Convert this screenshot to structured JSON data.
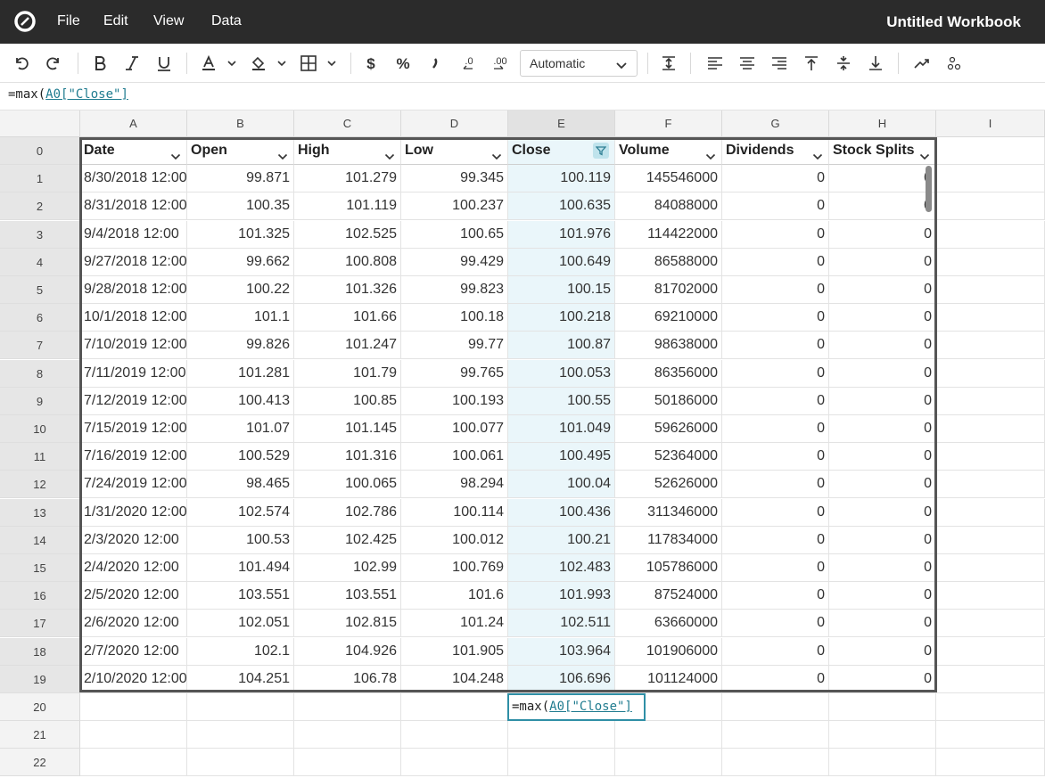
{
  "app": {
    "menu": [
      "File",
      "Edit",
      "View",
      "Data"
    ],
    "title": "Untitled Workbook"
  },
  "toolbar": {
    "number_format": "Automatic",
    "icons": [
      "undo-icon",
      "redo-icon",
      "bold-icon",
      "italic-icon",
      "underline-icon",
      "text-color-icon",
      "fill-color-icon",
      "borders-icon",
      "currency-icon",
      "percent-icon",
      "comma-icon",
      "decrease-decimal-icon",
      "increase-decimal-icon",
      "row-height-icon",
      "align-left-icon",
      "align-center-icon",
      "align-right-icon",
      "align-top-icon",
      "align-middle-icon",
      "align-bottom-icon",
      "chart-icon",
      "more-icon"
    ]
  },
  "formula_bar": {
    "prefix": "=max(",
    "ref": "A0[\"Close\"]"
  },
  "columns": [
    "A",
    "B",
    "C",
    "D",
    "E",
    "F",
    "G",
    "H",
    "I"
  ],
  "selected_column": "E",
  "table": {
    "headers": [
      "Date",
      "Open",
      "High",
      "Low",
      "Close",
      "Volume",
      "Dividends",
      "Stock Splits"
    ],
    "rows": [
      [
        "8/30/2018 12:00",
        "99.871",
        "101.279",
        "99.345",
        "100.119",
        "145546000",
        "0",
        "0"
      ],
      [
        "8/31/2018 12:00",
        "100.35",
        "101.119",
        "100.237",
        "100.635",
        "84088000",
        "0",
        "0"
      ],
      [
        "9/4/2018 12:00",
        "101.325",
        "102.525",
        "100.65",
        "101.976",
        "114422000",
        "0",
        "0"
      ],
      [
        "9/27/2018 12:00",
        "99.662",
        "100.808",
        "99.429",
        "100.649",
        "86588000",
        "0",
        "0"
      ],
      [
        "9/28/2018 12:00",
        "100.22",
        "101.326",
        "99.823",
        "100.15",
        "81702000",
        "0",
        "0"
      ],
      [
        "10/1/2018 12:00",
        "101.1",
        "101.66",
        "100.18",
        "100.218",
        "69210000",
        "0",
        "0"
      ],
      [
        "7/10/2019 12:00",
        "99.826",
        "101.247",
        "99.77",
        "100.87",
        "98638000",
        "0",
        "0"
      ],
      [
        "7/11/2019 12:00",
        "101.281",
        "101.79",
        "99.765",
        "100.053",
        "86356000",
        "0",
        "0"
      ],
      [
        "7/12/2019 12:00",
        "100.413",
        "100.85",
        "100.193",
        "100.55",
        "50186000",
        "0",
        "0"
      ],
      [
        "7/15/2019 12:00",
        "101.07",
        "101.145",
        "100.077",
        "101.049",
        "59626000",
        "0",
        "0"
      ],
      [
        "7/16/2019 12:00",
        "100.529",
        "101.316",
        "100.061",
        "100.495",
        "52364000",
        "0",
        "0"
      ],
      [
        "7/24/2019 12:00",
        "98.465",
        "100.065",
        "98.294",
        "100.04",
        "52626000",
        "0",
        "0"
      ],
      [
        "1/31/2020 12:00",
        "102.574",
        "102.786",
        "100.114",
        "100.436",
        "311346000",
        "0",
        "0"
      ],
      [
        "2/3/2020 12:00",
        "100.53",
        "102.425",
        "100.012",
        "100.21",
        "117834000",
        "0",
        "0"
      ],
      [
        "2/4/2020 12:00",
        "101.494",
        "102.99",
        "100.769",
        "102.483",
        "105786000",
        "0",
        "0"
      ],
      [
        "2/5/2020 12:00",
        "103.551",
        "103.551",
        "101.6",
        "101.993",
        "87524000",
        "0",
        "0"
      ],
      [
        "2/6/2020 12:00",
        "102.051",
        "102.815",
        "101.24",
        "102.511",
        "63660000",
        "0",
        "0"
      ],
      [
        "2/7/2020 12:00",
        "102.1",
        "104.926",
        "101.905",
        "103.964",
        "101906000",
        "0",
        "0"
      ],
      [
        "2/10/2020 12:00",
        "104.251",
        "106.78",
        "104.248",
        "106.696",
        "101124000",
        "0",
        "0"
      ]
    ]
  },
  "row_numbers": [
    "0",
    "1",
    "2",
    "3",
    "4",
    "5",
    "6",
    "7",
    "8",
    "9",
    "10",
    "11",
    "12",
    "13",
    "14",
    "15",
    "16",
    "17",
    "18",
    "19",
    "20",
    "21",
    "22"
  ],
  "editing_cell": {
    "prefix": "=max(",
    "ref": "A0[\"Close\"]"
  }
}
